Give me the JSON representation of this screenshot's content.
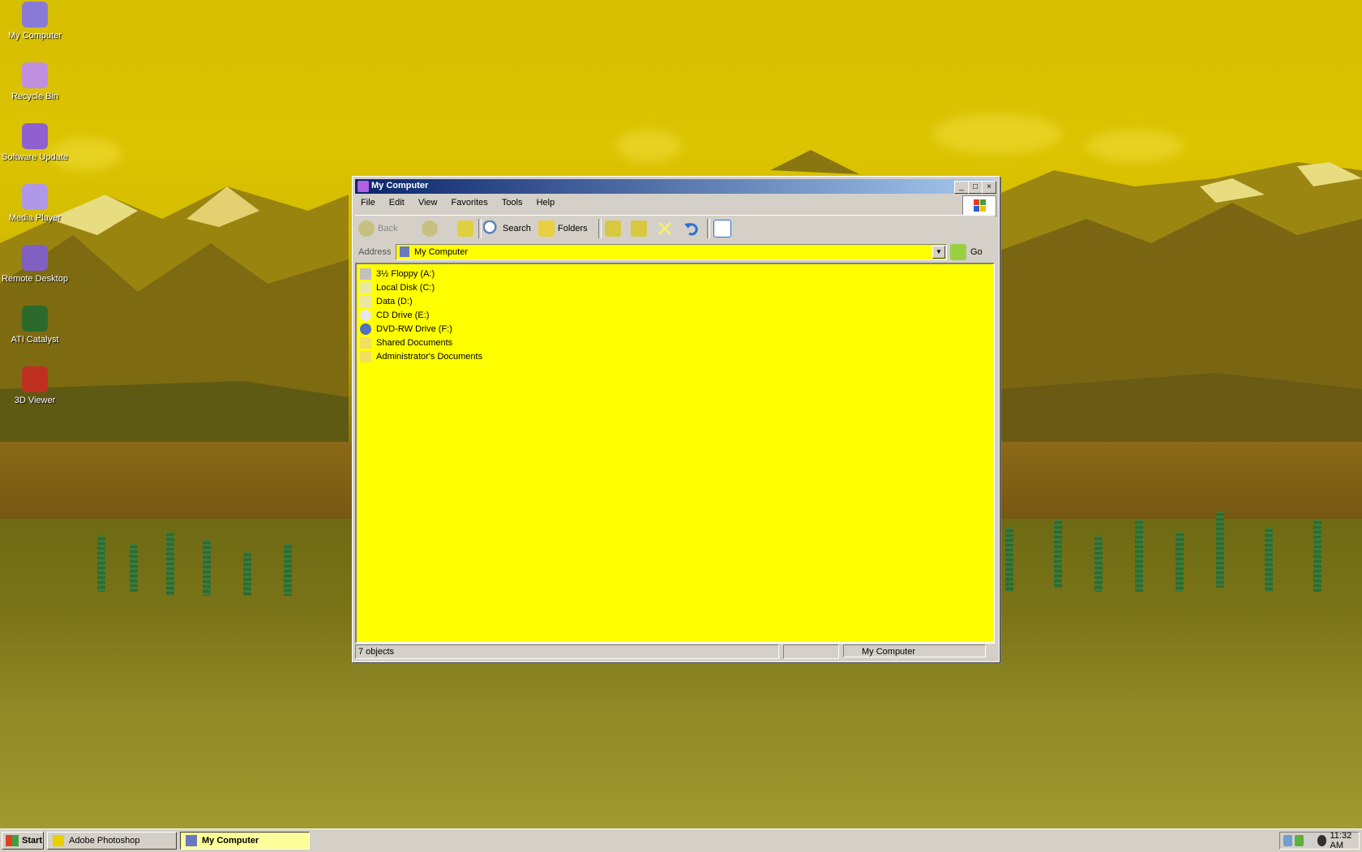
{
  "desktop": {
    "icons": [
      {
        "label": "My Computer",
        "icon": "computer-icon",
        "color": "#8a7ad8"
      },
      {
        "label": "Recycle Bin",
        "icon": "recycle-bin-icon",
        "color": "#c090e0"
      },
      {
        "label": "Software Update",
        "icon": "update-icon",
        "color": "#9060d0"
      },
      {
        "label": "Media Player",
        "icon": "media-player-icon",
        "color": "#b098e8"
      },
      {
        "label": "Remote Desktop",
        "icon": "remote-desktop-icon",
        "color": "#8060c0"
      },
      {
        "label": "ATI Catalyst",
        "icon": "ati-icon",
        "color": "#2c6a2c"
      },
      {
        "label": "3D Viewer",
        "icon": "3d-viewer-icon",
        "color": "#c03020"
      }
    ]
  },
  "window": {
    "title": "My Computer",
    "menu": [
      "File",
      "Edit",
      "View",
      "Favorites",
      "Tools",
      "Help"
    ],
    "toolbar": {
      "back_label": "Back",
      "search_label": "Search",
      "folders_label": "Folders"
    },
    "address": {
      "label": "Address",
      "value": "My Computer",
      "go_label": "Go"
    },
    "items": [
      {
        "label": "3½ Floppy (A:)",
        "icon": "floppy-icon",
        "color": "#c0c0c0"
      },
      {
        "label": "Local Disk (C:)",
        "icon": "hard-disk-icon",
        "color": "#e8e8a0"
      },
      {
        "label": "Data (D:)",
        "icon": "hard-disk-icon",
        "color": "#e8e8a0"
      },
      {
        "label": "CD Drive (E:)",
        "icon": "cd-drive-icon",
        "color": "#e8e8e8"
      },
      {
        "label": "DVD-RW Drive (F:)",
        "icon": "dvd-icon",
        "color": "#5070c0"
      },
      {
        "label": "Shared Documents",
        "icon": "folder-icon",
        "color": "#f0e060"
      },
      {
        "label": "Administrator's Documents",
        "icon": "folder-icon",
        "color": "#f0e060"
      }
    ],
    "status": {
      "objects": "7 objects",
      "location": "My Computer"
    }
  },
  "taskbar": {
    "start_label": "Start",
    "tasks": [
      {
        "label": "Adobe Photoshop",
        "icon": "photoshop-icon",
        "active": false
      },
      {
        "label": "My Computer",
        "icon": "computer-icon",
        "active": true
      }
    ],
    "clock": "11:32 AM"
  }
}
